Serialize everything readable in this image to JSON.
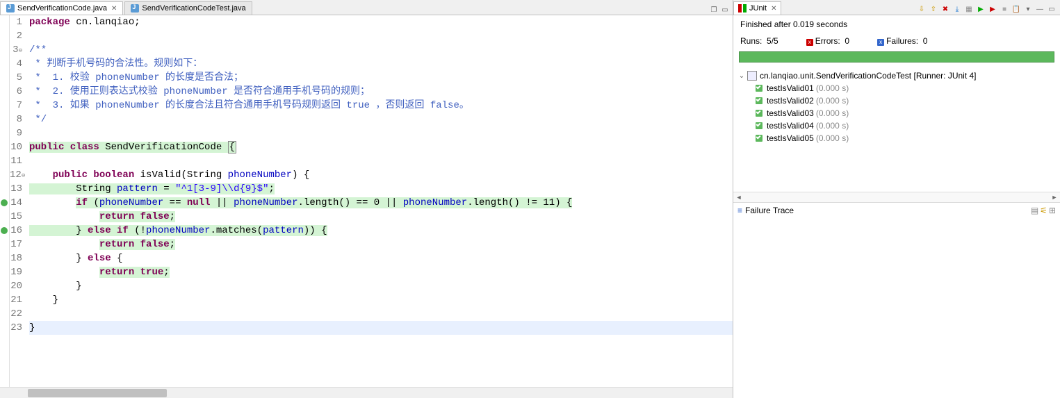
{
  "tabs": [
    {
      "label": "SendVerificationCode.java",
      "active": true,
      "icon": "java-file-icon"
    },
    {
      "label": "SendVerificationCodeTest.java",
      "active": false,
      "icon": "java-file-icon"
    }
  ],
  "code": {
    "lines": [
      {
        "n": "1",
        "seg": [
          {
            "t": "package ",
            "c": "kw"
          },
          {
            "t": "cn.lanqiao;",
            "c": "id"
          }
        ]
      },
      {
        "n": "2",
        "seg": []
      },
      {
        "n": "3",
        "fold": true,
        "seg": [
          {
            "t": "/**",
            "c": "cm"
          }
        ]
      },
      {
        "n": "4",
        "seg": [
          {
            "t": " * 判断手机号码的合法性。规则如下：",
            "c": "cm"
          }
        ]
      },
      {
        "n": "5",
        "seg": [
          {
            "t": " *  1. 校验 phoneNumber 的长度是否合法；",
            "c": "cm"
          }
        ]
      },
      {
        "n": "6",
        "seg": [
          {
            "t": " *  2. 使用正则表达式校验 phoneNumber 是否符合通用手机号码的规则；",
            "c": "cm"
          }
        ]
      },
      {
        "n": "7",
        "seg": [
          {
            "t": " *  3. 如果 phoneNumber 的长度合法且符合通用手机号码规则返回 true ，否则返回 false。",
            "c": "cm"
          }
        ]
      },
      {
        "n": "8",
        "seg": [
          {
            "t": " */",
            "c": "cm"
          }
        ]
      },
      {
        "n": "9",
        "seg": []
      },
      {
        "n": "10",
        "hl": true,
        "seg": [
          {
            "t": "public class ",
            "c": "kw",
            "h": 1
          },
          {
            "t": "SendVerificationCode ",
            "c": "id",
            "h": 1
          },
          {
            "t": "{",
            "c": "id",
            "h": 1,
            "box": 1
          }
        ]
      },
      {
        "n": "11",
        "seg": []
      },
      {
        "n": "12",
        "fold": true,
        "seg": [
          {
            "t": "    ",
            "c": "id"
          },
          {
            "t": "public boolean ",
            "c": "kw"
          },
          {
            "t": "isValid(String ",
            "c": "id"
          },
          {
            "t": "phoneNumber",
            "c": "fld"
          },
          {
            "t": ") {",
            "c": "id"
          }
        ]
      },
      {
        "n": "13",
        "hl": true,
        "seg": [
          {
            "t": "        String ",
            "c": "id",
            "h": 1
          },
          {
            "t": "pattern",
            "c": "fld",
            "h": 1
          },
          {
            "t": " = ",
            "c": "id",
            "h": 1
          },
          {
            "t": "\"^1[3-9]\\\\d{9}$\"",
            "c": "str",
            "h": 1
          },
          {
            "t": ";",
            "c": "id",
            "h": 1
          }
        ]
      },
      {
        "n": "14",
        "hl": true,
        "mark": "g",
        "seg": [
          {
            "t": "        ",
            "c": "id"
          },
          {
            "t": "if ",
            "c": "kw",
            "h": 1
          },
          {
            "t": "(",
            "c": "id",
            "h": 1
          },
          {
            "t": "phoneNumber",
            "c": "fld",
            "h": 1
          },
          {
            "t": " == ",
            "c": "id",
            "h": 1
          },
          {
            "t": "null ",
            "c": "kw",
            "h": 1
          },
          {
            "t": "|| ",
            "c": "id",
            "h": 1
          },
          {
            "t": "phoneNumber",
            "c": "fld",
            "h": 1
          },
          {
            "t": ".length() == 0 || ",
            "c": "id",
            "h": 1
          },
          {
            "t": "phoneNumber",
            "c": "fld",
            "h": 1
          },
          {
            "t": ".length() != 11) {",
            "c": "id",
            "h": 1
          }
        ]
      },
      {
        "n": "15",
        "hl": true,
        "seg": [
          {
            "t": "            ",
            "c": "id"
          },
          {
            "t": "return false",
            "c": "kw",
            "h": 1
          },
          {
            "t": ";",
            "c": "id",
            "h": 1
          }
        ]
      },
      {
        "n": "16",
        "hl": true,
        "mark": "g",
        "seg": [
          {
            "t": "        } ",
            "c": "id",
            "h": 1
          },
          {
            "t": "else if ",
            "c": "kw",
            "h": 1
          },
          {
            "t": "(!",
            "c": "id",
            "h": 1
          },
          {
            "t": "phoneNumber",
            "c": "fld",
            "h": 1
          },
          {
            "t": ".matches(",
            "c": "id",
            "h": 1
          },
          {
            "t": "pattern",
            "c": "fld",
            "h": 1
          },
          {
            "t": ")) {",
            "c": "id",
            "h": 1
          }
        ]
      },
      {
        "n": "17",
        "hl": true,
        "seg": [
          {
            "t": "            ",
            "c": "id"
          },
          {
            "t": "return false",
            "c": "kw",
            "h": 1
          },
          {
            "t": ";",
            "c": "id",
            "h": 1
          }
        ]
      },
      {
        "n": "18",
        "seg": [
          {
            "t": "        } ",
            "c": "id"
          },
          {
            "t": "else ",
            "c": "kw"
          },
          {
            "t": "{",
            "c": "id"
          }
        ]
      },
      {
        "n": "19",
        "hl": true,
        "seg": [
          {
            "t": "            ",
            "c": "id"
          },
          {
            "t": "return true",
            "c": "kw",
            "h": 1
          },
          {
            "t": ";",
            "c": "id",
            "h": 1
          }
        ]
      },
      {
        "n": "20",
        "seg": [
          {
            "t": "        }",
            "c": "id"
          }
        ]
      },
      {
        "n": "21",
        "seg": [
          {
            "t": "    }",
            "c": "id"
          }
        ]
      },
      {
        "n": "22",
        "seg": []
      },
      {
        "n": "23",
        "cur": true,
        "seg": [
          {
            "t": "}",
            "c": "id"
          }
        ]
      }
    ]
  },
  "junit": {
    "tab_label": "JUnit",
    "status": "Finished after 0.019 seconds",
    "runs_label": "Runs:",
    "runs": "5/5",
    "errors_label": "Errors:",
    "errors": "0",
    "failures_label": "Failures:",
    "failures": "0",
    "root": "cn.lanqiao.unit.SendVerificationCodeTest [Runner: JUnit 4]",
    "tests": [
      {
        "name": "testIsValid01",
        "time": "(0.000 s)"
      },
      {
        "name": "testIsValid02",
        "time": "(0.000 s)"
      },
      {
        "name": "testIsValid03",
        "time": "(0.000 s)"
      },
      {
        "name": "testIsValid04",
        "time": "(0.000 s)"
      },
      {
        "name": "testIsValid05",
        "time": "(0.000 s)"
      }
    ],
    "failure_trace_label": "Failure Trace"
  }
}
